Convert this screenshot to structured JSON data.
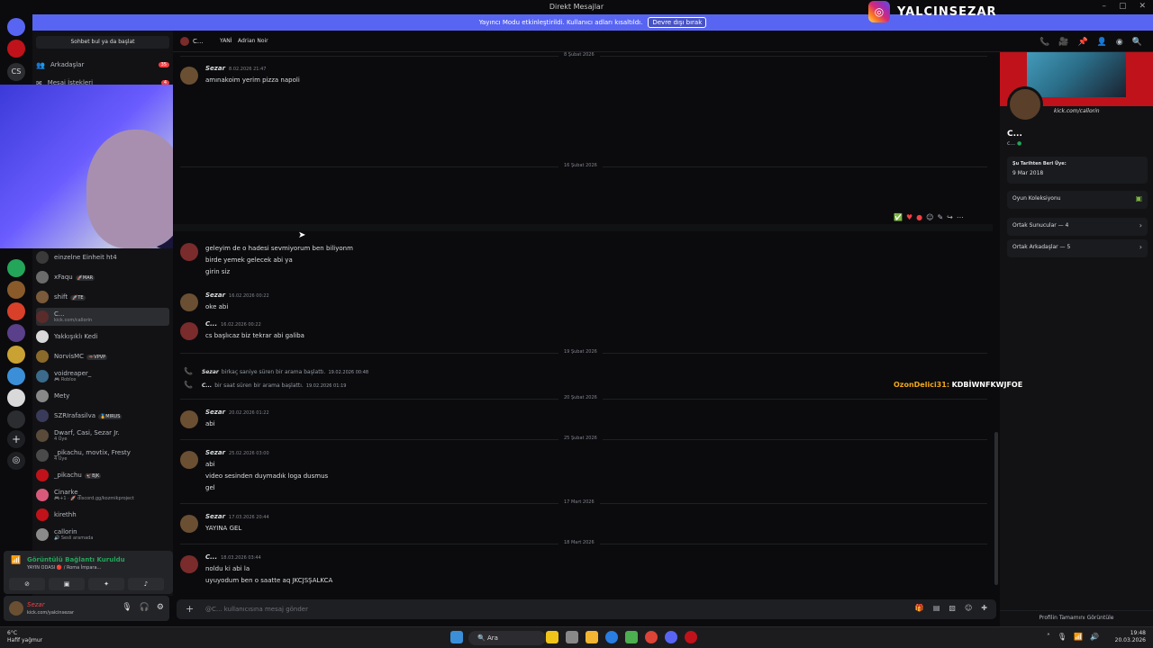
{
  "window": {
    "title": "Direkt Mesajlar"
  },
  "banner": {
    "text": "Yayıncı Modu etkinleştirildi. Kullanıcı adları kısaltıldı.",
    "button": "Devre dışı bırak"
  },
  "sidebar": {
    "search_placeholder": "Sohbet bul ya da başlat",
    "top": [
      {
        "label": "Arkadaşlar",
        "badge": "35"
      },
      {
        "label": "Mesaj İstekleri",
        "badge": "4"
      }
    ],
    "dms": [
      {
        "name": "einzelne Einheit ht4",
        "tag": "",
        "sub": ""
      },
      {
        "name": "xFaqu",
        "tag": "🚀MAR",
        "sub": ""
      },
      {
        "name": "shift",
        "tag": "🚀TE",
        "sub": ""
      },
      {
        "name": "C...",
        "tag": "",
        "sub": "kick.com/callorin"
      },
      {
        "name": "Yakkışıklı Kedi",
        "tag": "",
        "sub": ""
      },
      {
        "name": "NorvisMC",
        "tag": "🦇VPVP",
        "sub": ""
      },
      {
        "name": "voidreaper_",
        "tag": "",
        "sub": "🎮 Roblox"
      },
      {
        "name": "Mety",
        "tag": "",
        "sub": ""
      },
      {
        "name": "SZRIrafasilva",
        "tag": "🏅MIRUS",
        "sub": ""
      },
      {
        "name": "Dwarf, Casi, Sezar Jr.",
        "tag": "",
        "sub": "4 Üye"
      },
      {
        "name": "_pikachu, movtix, Fresty",
        "tag": "",
        "sub": "4 Üye"
      },
      {
        "name": "_pikachu",
        "tag": "🦅BJK",
        "sub": ""
      },
      {
        "name": "Cinarke_",
        "tag": "",
        "sub": "🎮+1 · 🚀 discord.gg/kozmikproject"
      },
      {
        "name": "kirethh",
        "tag": "",
        "sub": ""
      },
      {
        "name": "callorin",
        "tag": "",
        "sub": "🔊 Sesli aramada"
      }
    ]
  },
  "voice": {
    "status": "Görüntülü Bağlantı Kuruldu",
    "channel": "YAYIN ODASI 🔴 / Roma İmpara..."
  },
  "user": {
    "name": "Sezar",
    "status": "kick.com/yalcinsezar"
  },
  "chat_header": {
    "name": "C...",
    "nick": "YANİ",
    "alias": "Adrian Noir"
  },
  "messages": [
    {
      "type": "divider",
      "label": "8 Şubat 2026"
    },
    {
      "type": "msg",
      "author": "Sezar",
      "time": "8.02.2026 21:47",
      "lines": [
        "amınakoim yerim pizza napoli"
      ]
    },
    {
      "type": "divider",
      "label": "16 Şubat 2026"
    },
    {
      "type": "msg",
      "author": "",
      "time": "",
      "lines": [
        "geleyim de o hadesi sevmiyorum ben biliyonm",
        "birde yemek gelecek abi ya",
        "girin siz"
      ]
    },
    {
      "type": "msg",
      "author": "Sezar",
      "time": "16.02.2026 00:22",
      "lines": [
        "oke abi"
      ]
    },
    {
      "type": "msg",
      "author": "C...",
      "time": "16.02.2026 00:22",
      "lines": [
        "cs başlıcaz biz tekrar abi galiba"
      ]
    },
    {
      "type": "divider",
      "label": "19 Şubat 2026"
    },
    {
      "type": "call",
      "author": "Sezar",
      "text": "birkaç saniye süren bir arama başlattı.",
      "time": "19.02.2026 00:48"
    },
    {
      "type": "call",
      "author": "C...",
      "text": "bir saat süren bir arama başlattı.",
      "time": "19.02.2026 01:19"
    },
    {
      "type": "divider",
      "label": "20 Şubat 2026"
    },
    {
      "type": "msg",
      "author": "Sezar",
      "time": "20.02.2026 01:22",
      "lines": [
        "abi"
      ]
    },
    {
      "type": "divider",
      "label": "25 Şubat 2026"
    },
    {
      "type": "msg",
      "author": "Sezar",
      "time": "25.02.2026 03:00",
      "lines": [
        "abi",
        "video sesinden duymadık loga dusmus",
        "gel"
      ]
    },
    {
      "type": "divider",
      "label": "17 Mart 2026"
    },
    {
      "type": "msg",
      "author": "Sezar",
      "time": "17.03.2026 20:44",
      "lines": [
        "YAYINA GEL"
      ]
    },
    {
      "type": "divider",
      "label": "18 Mart 2026"
    },
    {
      "type": "msg",
      "author": "C...",
      "time": "18.03.2026 03:44",
      "lines": [
        "noldu ki abi la",
        "uyuyodum ben o saatte aq JKCJSŞALKCA"
      ]
    }
  ],
  "composer": {
    "placeholder": "@C... kullanıcısına mesaj gönder"
  },
  "profile": {
    "kick": "kick.com/callorin",
    "name": "C...",
    "sub": "c...",
    "member_label": "Şu Tarihten Beri Üye:",
    "member_date": "9 Mar 2018",
    "games": "Oyun Koleksiyonu",
    "servers": "Ortak Sunucular — 4",
    "friends": "Ortak Arkadaşlar — 5",
    "footer": "Profilin Tamamını Görüntüle"
  },
  "overlay": {
    "instagram": "YALCINSEZAR",
    "chat_user": "OzonDelici31:",
    "chat_msg": "KDBİWNFKWJFOE"
  },
  "taskbar": {
    "temp": "6°C",
    "weather": "Hafif yağmur",
    "search": "Ara",
    "time": "19:48",
    "date": "20.03.2026"
  },
  "colors": {
    "accent": "#5865f2",
    "online": "#23a55a",
    "danger": "#f23f43"
  }
}
